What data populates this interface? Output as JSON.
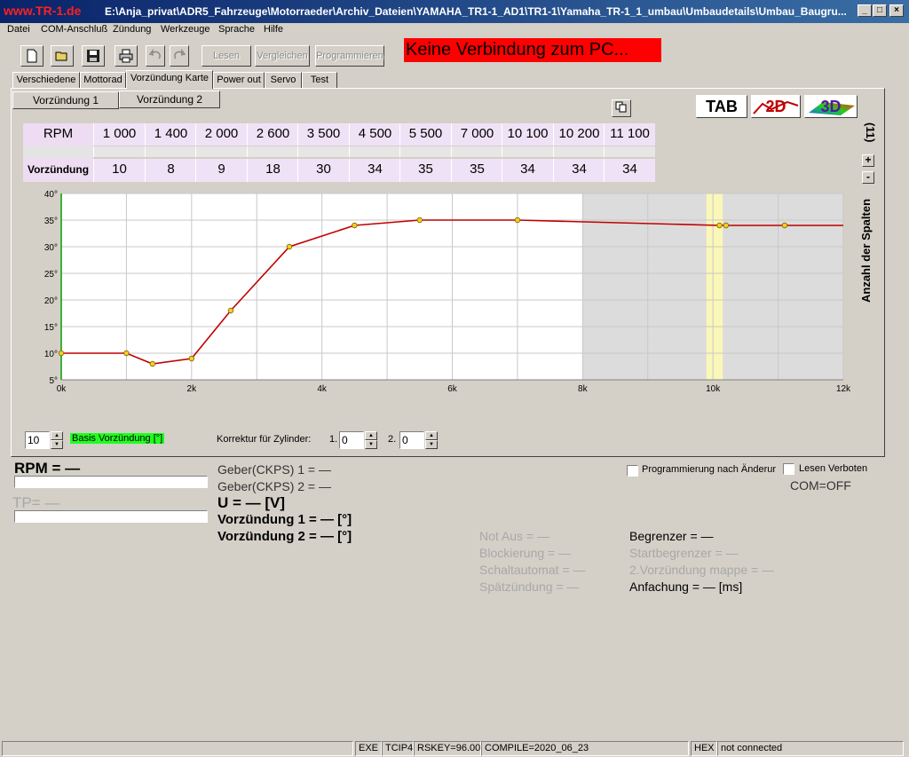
{
  "window": {
    "brand": "www.TR-1.de",
    "title_path": "E:\\Anja_privat\\ADR5_Fahrzeuge\\Motorraeder\\Archiv_Dateien\\YAMAHA_TR1-1_AD1\\TR1-1\\Yamaha_TR-1_1_umbau\\Umbaudetails\\Umbau_Baugru..."
  },
  "menu": [
    "Datei",
    "COM-Anschluß",
    "Zündung",
    "Werkzeuge",
    "Sprache",
    "Hilfe"
  ],
  "toolbar": {
    "lesen": "Lesen",
    "vergleichen": "Vergleichen",
    "programmieren": "Programmieren",
    "connection_status": "Keine Verbindung zum PC..."
  },
  "tabs": [
    "Verschiedene",
    "Mottorad",
    "Vorzündung Karte",
    "Power out",
    "Servo",
    "Test"
  ],
  "subtabs": [
    "Vorzündung 1",
    "Vorzündung 2"
  ],
  "views": {
    "tab": "TAB",
    "twod": "2D",
    "threed": "3D"
  },
  "columns": {
    "count_label": "(11)",
    "side_label": "Anzahl der Spalten",
    "plus": "+",
    "minus": "-"
  },
  "table": {
    "rpm_label": "RPM",
    "advance_label": "Vorzündung",
    "rpm": [
      "1 000",
      "1 400",
      "2 000",
      "2 600",
      "3 500",
      "4 500",
      "5 500",
      "7 000",
      "10 100",
      "10 200",
      "11 100"
    ],
    "advance": [
      "10",
      "8",
      "9",
      "18",
      "30",
      "34",
      "35",
      "35",
      "34",
      "34",
      "34"
    ]
  },
  "chart_data": {
    "type": "line",
    "x": [
      0,
      1000,
      1400,
      2000,
      2600,
      3500,
      4500,
      5500,
      7000,
      10100,
      10200,
      11100
    ],
    "y": [
      10,
      10,
      8,
      9,
      18,
      30,
      34,
      35,
      35,
      34,
      34,
      34
    ],
    "xlim": [
      0,
      12000
    ],
    "ylim": [
      5,
      40
    ],
    "x_ticks": [
      "0k",
      "2k",
      "4k",
      "6k",
      "8k",
      "10k",
      "12k"
    ],
    "y_ticks": [
      "5°",
      "10°",
      "15°",
      "20°",
      "25°",
      "30°",
      "35°",
      "40°"
    ],
    "shaded_from": 8000,
    "highlight_range": [
      9900,
      10150
    ],
    "grid": true,
    "line_color": "#c00000",
    "marker_color": "#f0d020"
  },
  "controls": {
    "basis_value": "10",
    "basis_label": "Basis Vorzündung [°]",
    "korrektur_label": "Korrektur für Zylinder:",
    "cyl1_label": "1.",
    "cyl1_value": "0",
    "cyl2_label": "2.",
    "cyl2_value": "0"
  },
  "status": {
    "rpm": "RPM = —",
    "tp": "TP= —",
    "rpm_progress": 0,
    "tp_progress": 0,
    "geber1": "Geber(CKPS) 1 = —",
    "geber2": "Geber(CKPS) 2 = —",
    "voltage": "U = — [V]",
    "vorz1": "Vorzündung 1 = — [°]",
    "vorz2": "Vorzündung 2 = — [°]",
    "prog_label": "Programmierung nach Änderur",
    "lesen_label": "Lesen Verboten",
    "com": "COM=OFF",
    "not_aus": "Not Aus = —",
    "blockierung": "Blockierung = —",
    "schaltautomat": "Schaltautomat = —",
    "spaetzuendung": "Spätzündung = —",
    "begrenzer": "Begrenzer = —",
    "startbegrenzer": "Startbegrenzer = —",
    "vorz_mappe": "2.Vorzündung mappe = —",
    "anfachung": "Anfachung = — [ms]"
  },
  "statusbar": {
    "exe": "EXE",
    "tcip": "TCIP4",
    "rskey": "RSKEY=96.00",
    "compile": "COMPILE=2020_06_23",
    "hex": "HEX",
    "connection": "not connected"
  }
}
